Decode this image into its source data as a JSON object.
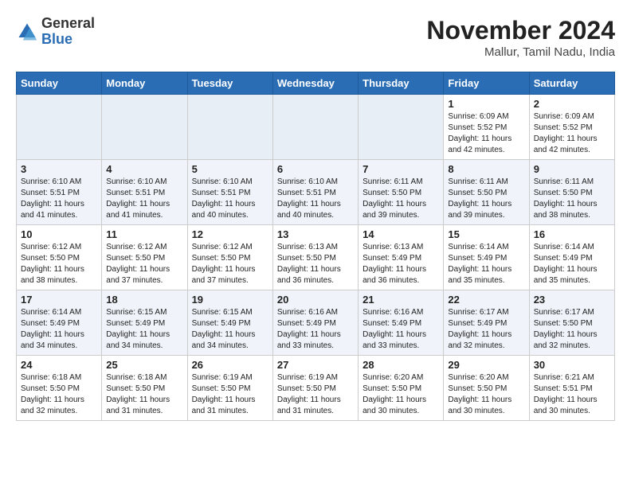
{
  "header": {
    "logo_general": "General",
    "logo_blue": "Blue",
    "month_title": "November 2024",
    "location": "Mallur, Tamil Nadu, India"
  },
  "weekdays": [
    "Sunday",
    "Monday",
    "Tuesday",
    "Wednesday",
    "Thursday",
    "Friday",
    "Saturday"
  ],
  "weeks": [
    [
      {
        "day": "",
        "info": ""
      },
      {
        "day": "",
        "info": ""
      },
      {
        "day": "",
        "info": ""
      },
      {
        "day": "",
        "info": ""
      },
      {
        "day": "",
        "info": ""
      },
      {
        "day": "1",
        "info": "Sunrise: 6:09 AM\nSunset: 5:52 PM\nDaylight: 11 hours\nand 42 minutes."
      },
      {
        "day": "2",
        "info": "Sunrise: 6:09 AM\nSunset: 5:52 PM\nDaylight: 11 hours\nand 42 minutes."
      }
    ],
    [
      {
        "day": "3",
        "info": "Sunrise: 6:10 AM\nSunset: 5:51 PM\nDaylight: 11 hours\nand 41 minutes."
      },
      {
        "day": "4",
        "info": "Sunrise: 6:10 AM\nSunset: 5:51 PM\nDaylight: 11 hours\nand 41 minutes."
      },
      {
        "day": "5",
        "info": "Sunrise: 6:10 AM\nSunset: 5:51 PM\nDaylight: 11 hours\nand 40 minutes."
      },
      {
        "day": "6",
        "info": "Sunrise: 6:10 AM\nSunset: 5:51 PM\nDaylight: 11 hours\nand 40 minutes."
      },
      {
        "day": "7",
        "info": "Sunrise: 6:11 AM\nSunset: 5:50 PM\nDaylight: 11 hours\nand 39 minutes."
      },
      {
        "day": "8",
        "info": "Sunrise: 6:11 AM\nSunset: 5:50 PM\nDaylight: 11 hours\nand 39 minutes."
      },
      {
        "day": "9",
        "info": "Sunrise: 6:11 AM\nSunset: 5:50 PM\nDaylight: 11 hours\nand 38 minutes."
      }
    ],
    [
      {
        "day": "10",
        "info": "Sunrise: 6:12 AM\nSunset: 5:50 PM\nDaylight: 11 hours\nand 38 minutes."
      },
      {
        "day": "11",
        "info": "Sunrise: 6:12 AM\nSunset: 5:50 PM\nDaylight: 11 hours\nand 37 minutes."
      },
      {
        "day": "12",
        "info": "Sunrise: 6:12 AM\nSunset: 5:50 PM\nDaylight: 11 hours\nand 37 minutes."
      },
      {
        "day": "13",
        "info": "Sunrise: 6:13 AM\nSunset: 5:50 PM\nDaylight: 11 hours\nand 36 minutes."
      },
      {
        "day": "14",
        "info": "Sunrise: 6:13 AM\nSunset: 5:49 PM\nDaylight: 11 hours\nand 36 minutes."
      },
      {
        "day": "15",
        "info": "Sunrise: 6:14 AM\nSunset: 5:49 PM\nDaylight: 11 hours\nand 35 minutes."
      },
      {
        "day": "16",
        "info": "Sunrise: 6:14 AM\nSunset: 5:49 PM\nDaylight: 11 hours\nand 35 minutes."
      }
    ],
    [
      {
        "day": "17",
        "info": "Sunrise: 6:14 AM\nSunset: 5:49 PM\nDaylight: 11 hours\nand 34 minutes."
      },
      {
        "day": "18",
        "info": "Sunrise: 6:15 AM\nSunset: 5:49 PM\nDaylight: 11 hours\nand 34 minutes."
      },
      {
        "day": "19",
        "info": "Sunrise: 6:15 AM\nSunset: 5:49 PM\nDaylight: 11 hours\nand 34 minutes."
      },
      {
        "day": "20",
        "info": "Sunrise: 6:16 AM\nSunset: 5:49 PM\nDaylight: 11 hours\nand 33 minutes."
      },
      {
        "day": "21",
        "info": "Sunrise: 6:16 AM\nSunset: 5:49 PM\nDaylight: 11 hours\nand 33 minutes."
      },
      {
        "day": "22",
        "info": "Sunrise: 6:17 AM\nSunset: 5:49 PM\nDaylight: 11 hours\nand 32 minutes."
      },
      {
        "day": "23",
        "info": "Sunrise: 6:17 AM\nSunset: 5:50 PM\nDaylight: 11 hours\nand 32 minutes."
      }
    ],
    [
      {
        "day": "24",
        "info": "Sunrise: 6:18 AM\nSunset: 5:50 PM\nDaylight: 11 hours\nand 32 minutes."
      },
      {
        "day": "25",
        "info": "Sunrise: 6:18 AM\nSunset: 5:50 PM\nDaylight: 11 hours\nand 31 minutes."
      },
      {
        "day": "26",
        "info": "Sunrise: 6:19 AM\nSunset: 5:50 PM\nDaylight: 11 hours\nand 31 minutes."
      },
      {
        "day": "27",
        "info": "Sunrise: 6:19 AM\nSunset: 5:50 PM\nDaylight: 11 hours\nand 31 minutes."
      },
      {
        "day": "28",
        "info": "Sunrise: 6:20 AM\nSunset: 5:50 PM\nDaylight: 11 hours\nand 30 minutes."
      },
      {
        "day": "29",
        "info": "Sunrise: 6:20 AM\nSunset: 5:50 PM\nDaylight: 11 hours\nand 30 minutes."
      },
      {
        "day": "30",
        "info": "Sunrise: 6:21 AM\nSunset: 5:51 PM\nDaylight: 11 hours\nand 30 minutes."
      }
    ]
  ]
}
